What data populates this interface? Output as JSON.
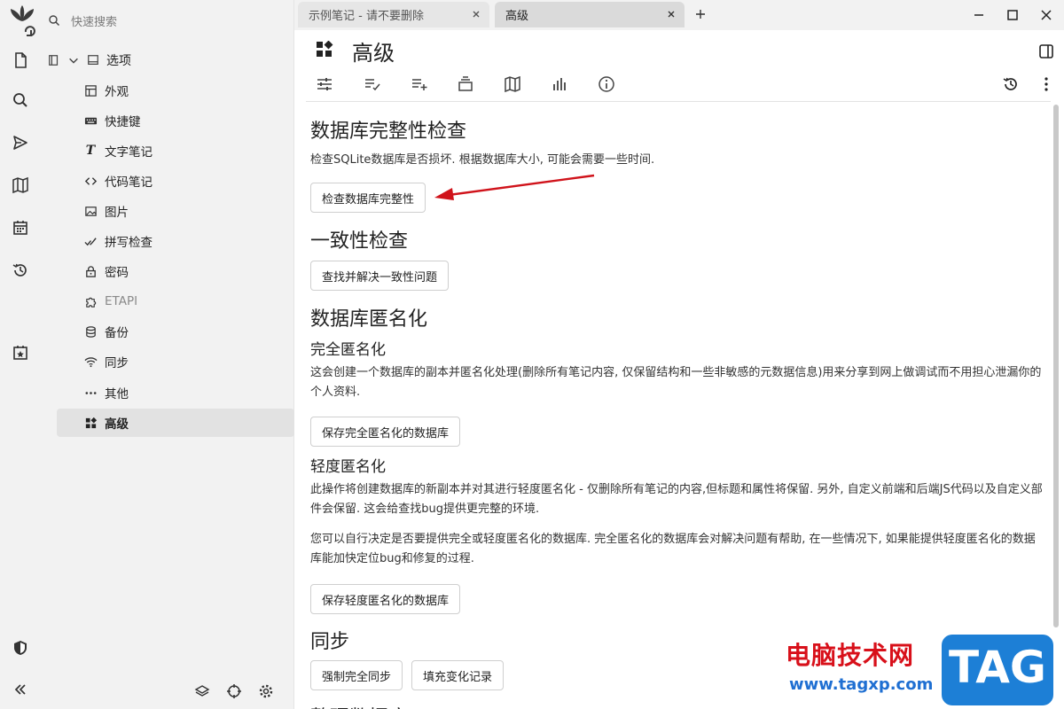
{
  "colors": {
    "sidebar_bg": "#f2f2f2",
    "active_item_bg": "#e2e2e2",
    "arrow": "#d0131b",
    "watermark_red": "#d8101a",
    "watermark_blue": "#1f6fd2"
  },
  "launcher": {
    "icons": [
      "trilium-logo-icon",
      "new-note-icon",
      "search-icon",
      "send-icon",
      "map-icon",
      "calendar-icon",
      "history-icon",
      "today-icon",
      "protected-session-icon",
      "collapse-icon"
    ]
  },
  "tree": {
    "search_placeholder": "快速搜索",
    "root_label": "选项",
    "items": [
      {
        "label": "外观",
        "icon": "layout-icon"
      },
      {
        "label": "快捷键",
        "icon": "keyboard-icon"
      },
      {
        "label": "文字笔记",
        "icon": "text-icon"
      },
      {
        "label": "代码笔记",
        "icon": "code-icon"
      },
      {
        "label": "图片",
        "icon": "image-icon"
      },
      {
        "label": "拼写检查",
        "icon": "spellcheck-icon"
      },
      {
        "label": "密码",
        "icon": "lock-icon"
      },
      {
        "label": "ETAPI",
        "icon": "extension-icon"
      },
      {
        "label": "备份",
        "icon": "database-icon"
      },
      {
        "label": "同步",
        "icon": "wifi-icon"
      },
      {
        "label": "其他",
        "icon": "dots-icon"
      },
      {
        "label": "高级",
        "icon": "dashboard-icon"
      }
    ]
  },
  "tabs": [
    {
      "label": "示例笔记 - 请不要删除"
    },
    {
      "label": "高级"
    }
  ],
  "note": {
    "title": "高级"
  },
  "sections": {
    "integrity_title": "数据库完整性检查",
    "integrity_desc": "检查SQLite数据库是否损坏. 根据数据库大小, 可能会需要一些时间.",
    "integrity_button": "检查数据库完整性",
    "consistency_title": "一致性检查",
    "consistency_button": "查找并解决一致性问题",
    "anon_title": "数据库匿名化",
    "full_anon_title": "完全匿名化",
    "full_anon_desc": "这会创建一个数据库的副本并匿名化处理(删除所有笔记内容, 仅保留结构和一些非敏感的元数据信息)用来分享到网上做调试而不用担心泄漏你的个人资料.",
    "full_anon_button": "保存完全匿名化的数据库",
    "light_anon_title": "轻度匿名化",
    "light_anon_desc": "此操作将创建数据库的新副本并对其进行轻度匿名化 - 仅删除所有笔记的内容,但标题和属性将保留. 另外, 自定义前端和后端JS代码以及自定义部件会保留. 这会给查找bug提供更完整的环境.",
    "choose_desc": "您可以自行决定是否要提供完全或轻度匿名化的数据库. 完全匿名化的数据库会对解决问题有帮助, 在一些情况下, 如果能提供轻度匿名化的数据库能加快定位bug和修复的过程.",
    "light_anon_button": "保存轻度匿名化的数据库",
    "sync_title": "同步",
    "force_sync_button": "强制完全同步",
    "fill_changes_button": "填充变化记录",
    "next_title": "整理数据库"
  },
  "watermark": {
    "site_name": "电脑技术网",
    "url": "www.tagxp.com",
    "tag": "TAG"
  }
}
